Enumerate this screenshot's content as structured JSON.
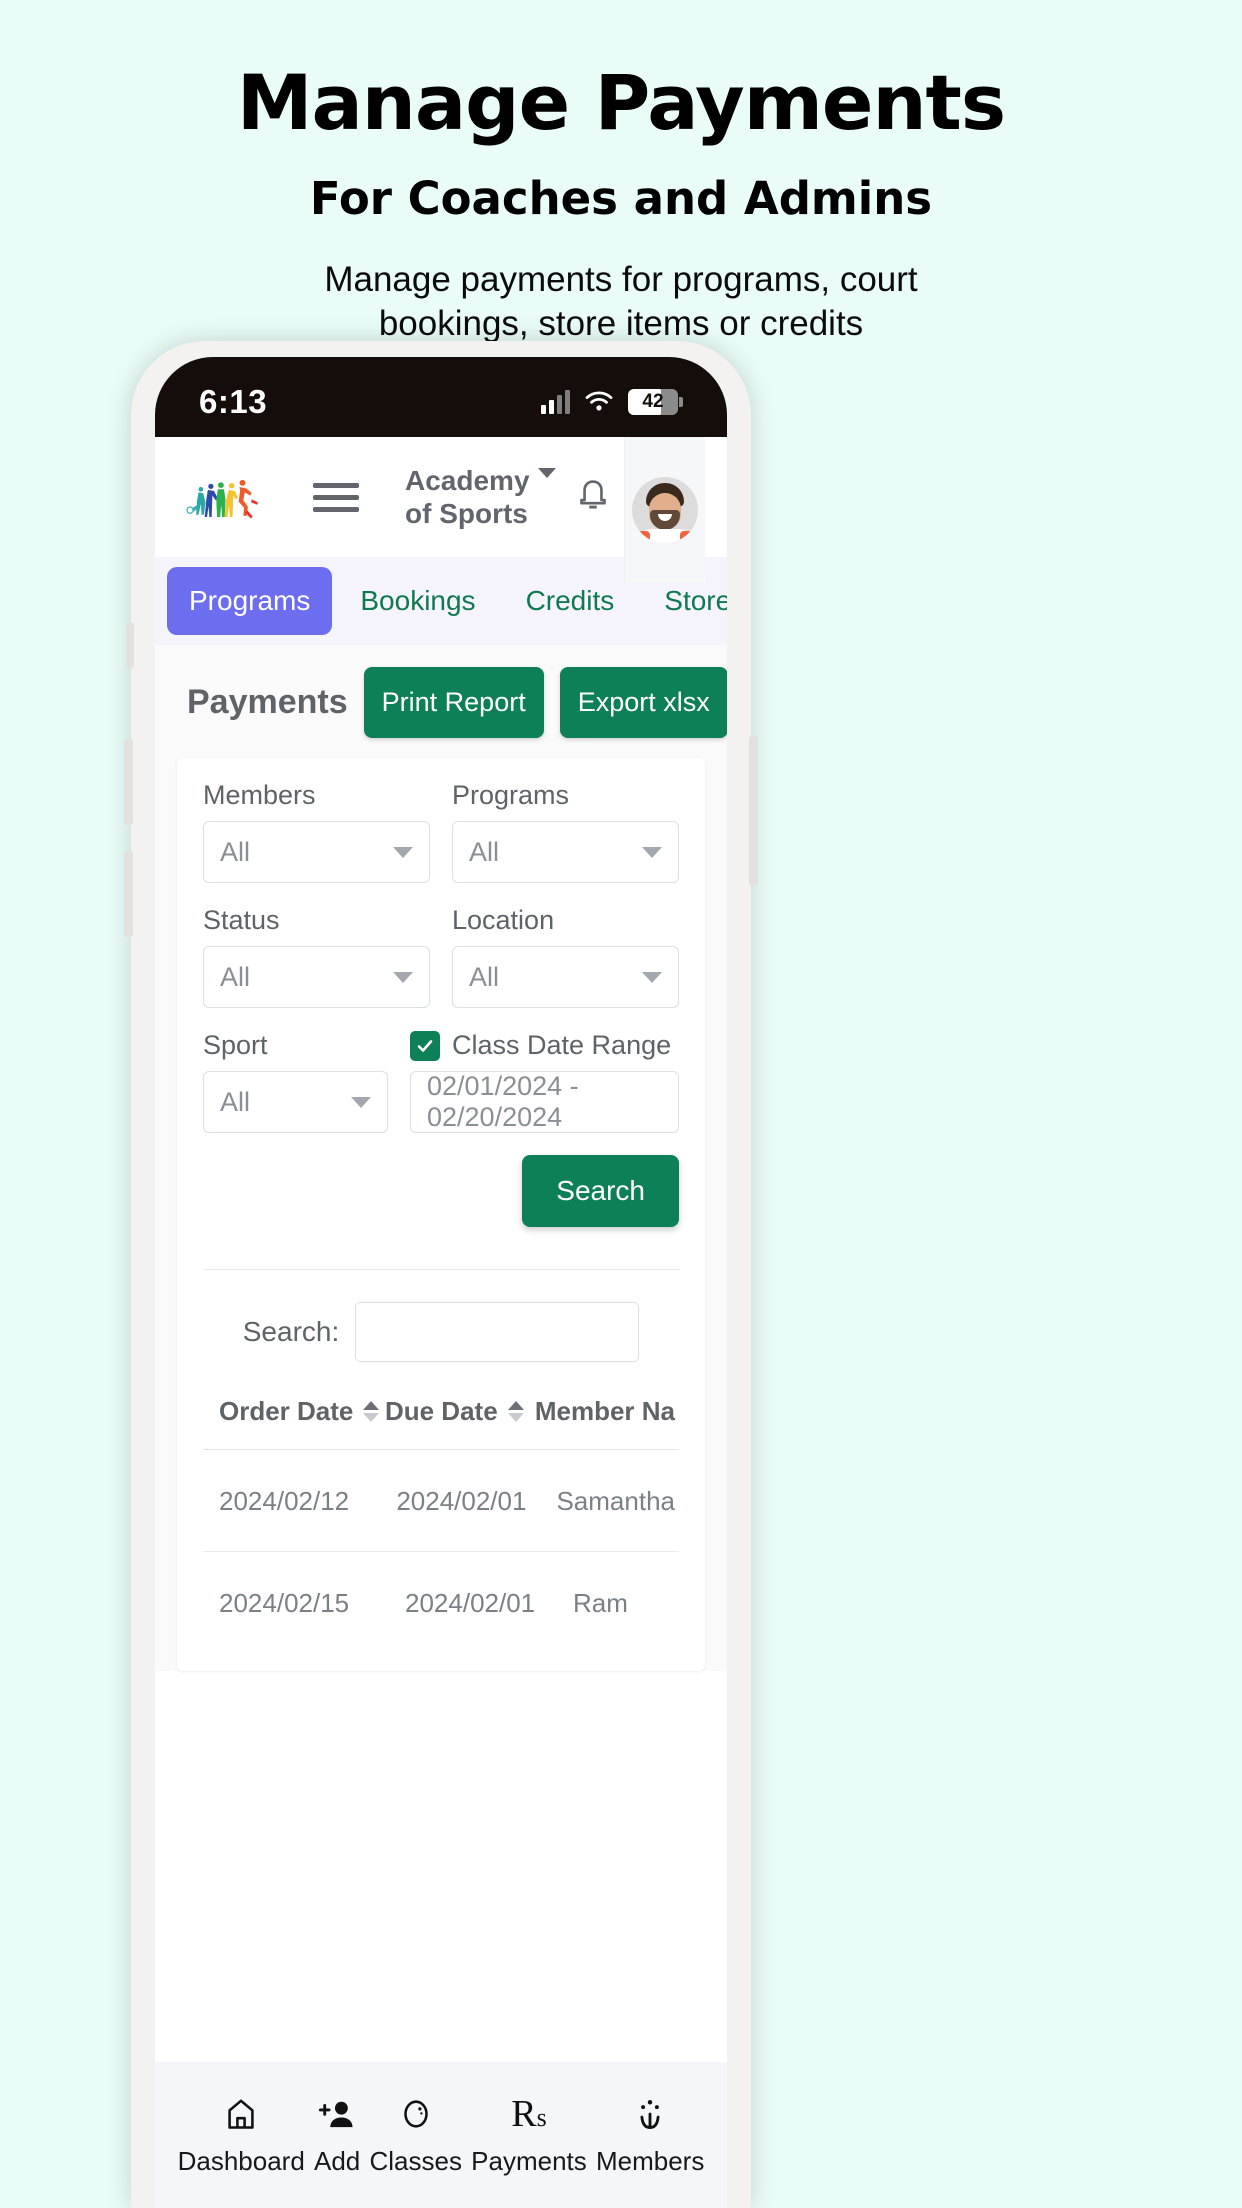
{
  "promo": {
    "title": "Manage Payments",
    "subtitle": "For Coaches and Admins",
    "description": "Manage payments for programs, court bookings, store items or credits"
  },
  "statusbar": {
    "time": "6:13",
    "battery": "42",
    "signal_icon": "cellular-signal-icon",
    "wifi_icon": "wifi-icon",
    "battery_icon": "battery-icon"
  },
  "app_header": {
    "logo_icon": "sports-people-logo",
    "menu_icon": "hamburger-menu-icon",
    "org_name": "Academy\nof Sports",
    "dropdown_icon": "chevron-down-icon",
    "bell_icon": "bell-icon",
    "refresh_icon": "refresh-icon",
    "avatar_icon": "user-avatar"
  },
  "tabs": [
    {
      "label": "Programs",
      "active": true
    },
    {
      "label": "Bookings",
      "active": false
    },
    {
      "label": "Credits",
      "active": false
    },
    {
      "label": "Store",
      "active": false
    }
  ],
  "page": {
    "title": "Payments",
    "print_report": "Print Report",
    "export_xlsx": "Export xlsx"
  },
  "filters": {
    "members": {
      "label": "Members",
      "value": "All"
    },
    "programs": {
      "label": "Programs",
      "value": "All"
    },
    "status": {
      "label": "Status",
      "value": "All"
    },
    "location": {
      "label": "Location",
      "value": "All"
    },
    "sport": {
      "label": "Sport",
      "value": "All"
    },
    "class_date_range": {
      "label": "Class Date Range",
      "checked": true,
      "value": "02/01/2024 - 02/20/2024"
    },
    "search_button": "Search"
  },
  "table": {
    "search_label": "Search:",
    "search_value": "",
    "search_placeholder": "",
    "columns": [
      "Order Date",
      "Due Date",
      "Member Na"
    ],
    "rows": [
      {
        "order_date": "2024/02/12",
        "due_date": "2024/02/01",
        "member_name": "Samantha"
      },
      {
        "order_date": "2024/02/15",
        "due_date": "2024/02/01",
        "member_name": "Ram"
      }
    ]
  },
  "bottom_nav": [
    {
      "label": "Dashboard",
      "icon": "home-icon"
    },
    {
      "label": "Add",
      "icon": "add-person-icon"
    },
    {
      "label": "Classes",
      "icon": "whistle-icon"
    },
    {
      "label": "Payments",
      "icon": "rupee-icon"
    },
    {
      "label": "Members",
      "icon": "members-icon"
    }
  ],
  "colors": {
    "background": "#e9fcf8",
    "accent_green": "#0e8057",
    "tab_active": "#6d6df0",
    "tab_text": "#0f7a52"
  }
}
